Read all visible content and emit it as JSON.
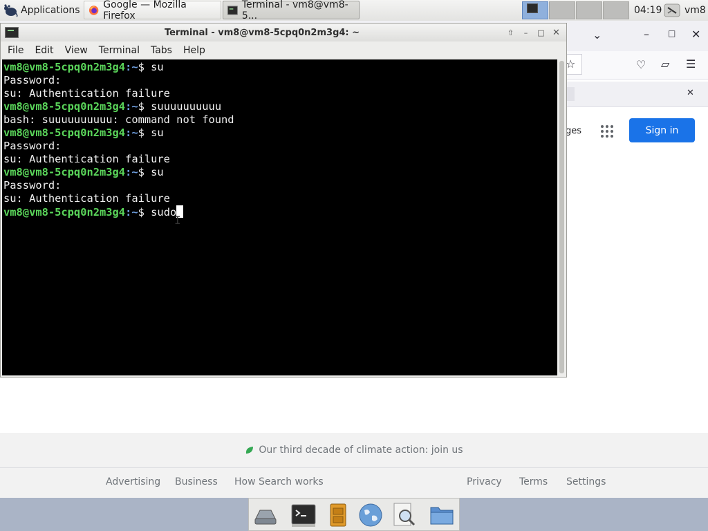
{
  "top_panel": {
    "applications_label": "Applications",
    "tasks": [
      {
        "label": "Google — Mozilla Firefox",
        "active": false
      },
      {
        "label": "Terminal - vm8@vm8-5...",
        "active": true
      }
    ],
    "clock": "04:19",
    "user": "vm8"
  },
  "firefox": {
    "sign_in_label": "Sign in",
    "images_link_partial": "ges",
    "footer_message": "Our third decade of climate action: join us",
    "footer_links_left": [
      "Advertising",
      "Business",
      "How Search works"
    ],
    "footer_links_right": [
      "Privacy",
      "Terms",
      "Settings"
    ],
    "sign_in_color": "#1a73e8"
  },
  "terminal": {
    "title": "Terminal - vm8@vm8-5cpq0n2m3g4: ~",
    "menu": [
      "File",
      "Edit",
      "View",
      "Terminal",
      "Tabs",
      "Help"
    ],
    "prompt_host": "vm8@vm8-5cpq0n2m3g4",
    "prompt_path": ":~",
    "prompt_symbol": "$ ",
    "lines": [
      {
        "type": "cmd",
        "text": "su"
      },
      {
        "type": "out",
        "text": "Password:"
      },
      {
        "type": "out",
        "text": "su: Authentication failure"
      },
      {
        "type": "cmd",
        "text": "suuuuuuuuuu"
      },
      {
        "type": "out",
        "text": "bash: suuuuuuuuuu: command not found"
      },
      {
        "type": "cmd",
        "text": "su"
      },
      {
        "type": "out",
        "text": "Password:"
      },
      {
        "type": "out",
        "text": "su: Authentication failure"
      },
      {
        "type": "cmd",
        "text": "su"
      },
      {
        "type": "out",
        "text": "Password:"
      },
      {
        "type": "out",
        "text": "su: Authentication failure"
      },
      {
        "type": "cmd",
        "text": "sudo",
        "cursor": true
      }
    ],
    "colors": {
      "prompt_host": "#5ad55a",
      "prompt_path": "#6f9fe0",
      "background": "#000000",
      "text": "#f0f0f0"
    }
  },
  "dock": {
    "items": [
      "drive-icon",
      "terminal-icon",
      "file-cabinet-icon",
      "web-browser-icon",
      "search-icon",
      "folder-icon"
    ]
  }
}
